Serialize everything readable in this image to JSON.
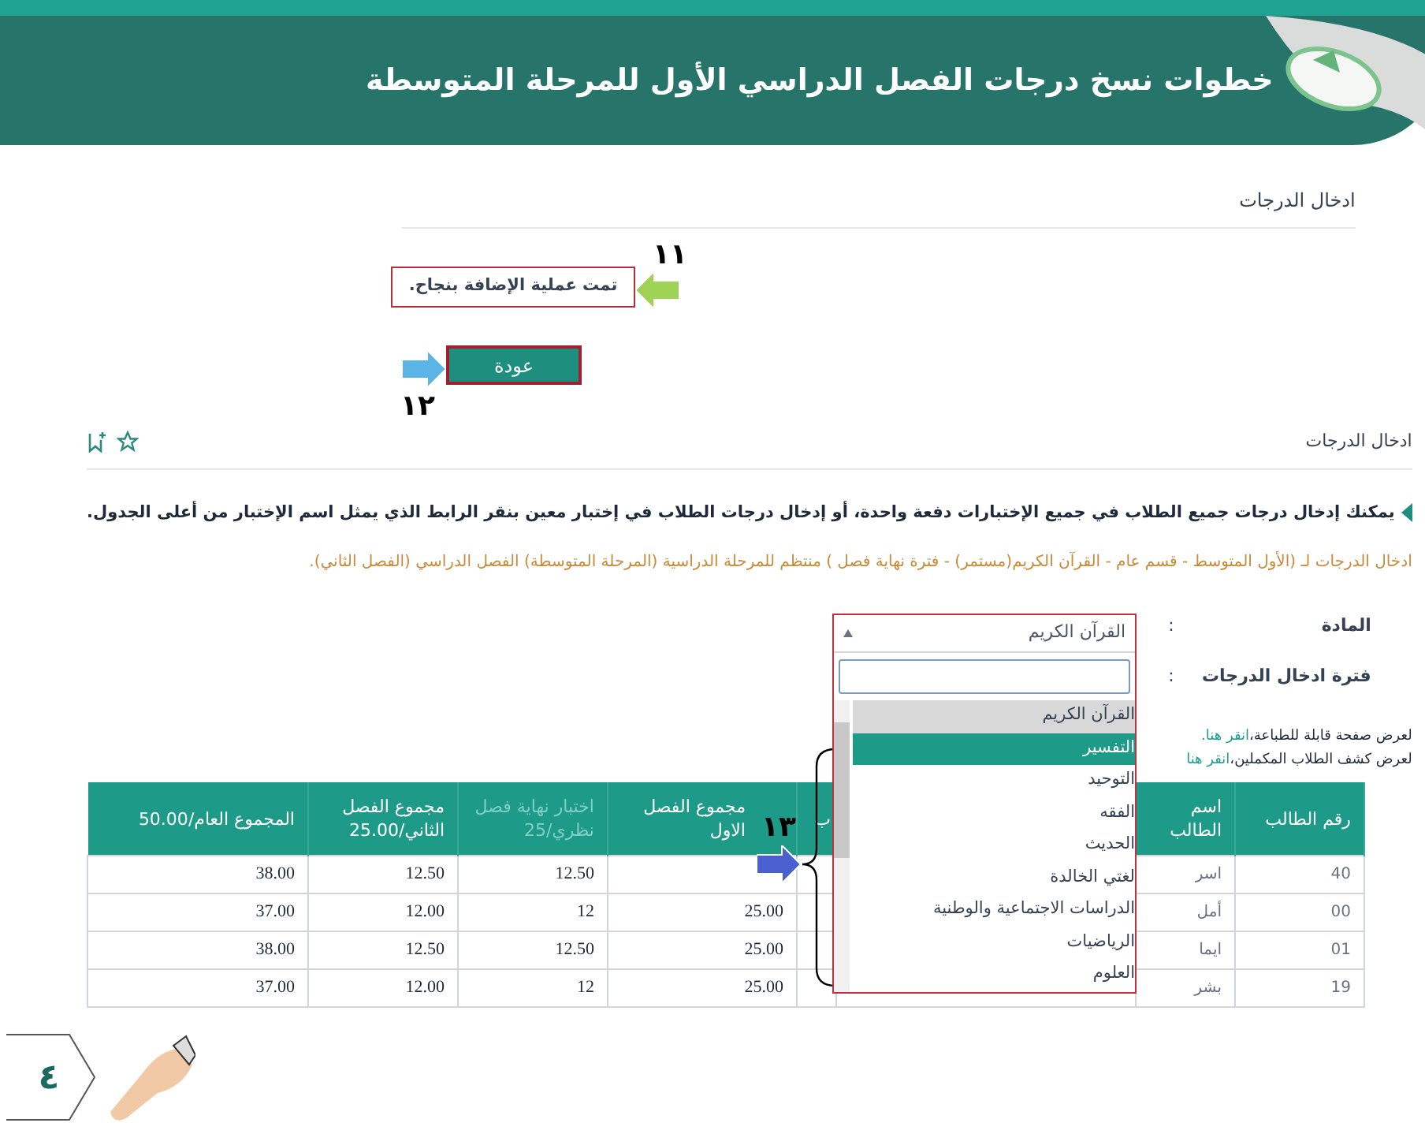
{
  "header": {
    "title": "خطوات نسخ درجات الفصل الدراسي الأول للمرحلة المتوسطة"
  },
  "result_panel": {
    "heading": "ادخال الدرجات",
    "message": "تمت عملية الإضافة بنجاح.",
    "back_button": "عودة"
  },
  "annotations": [
    {
      "number": "١١"
    },
    {
      "number": "١٢"
    },
    {
      "number": "١٣"
    }
  ],
  "grades_panel": {
    "heading": "ادخال الدرجات",
    "instruction": "يمكنك إدخال درجات جميع الطلاب في جميع الإختبارات دفعة واحدة، أو إدخال درجات الطلاب في إختبار معين بنقر الرابط الذي يمثل اسم الإختبار من أعلى الجدول.",
    "context": "ادخال الدرجات لـ (الأول المتوسط - قسم عام - القرآن الكريم(مستمر) - فترة نهاية فصل ) منتظم للمرحلة الدراسية (المرحلة المتوسطة) الفصل الدراسي (الفصل الثاني).",
    "fields": [
      {
        "label": "المادة",
        "colon": ":"
      },
      {
        "label": "فترة ادخال الدرجات",
        "colon": ":"
      }
    ],
    "subject_select": {
      "value": "القرآن الكريم",
      "expanded": true,
      "options": [
        {
          "label": "القرآن الكريم",
          "selected": true,
          "highlighted": false
        },
        {
          "label": "التفسير",
          "selected": false,
          "highlighted": true
        },
        {
          "label": "التوحيد",
          "selected": false,
          "highlighted": false
        },
        {
          "label": "الفقه",
          "selected": false,
          "highlighted": false
        },
        {
          "label": "الحديث",
          "selected": false,
          "highlighted": false
        },
        {
          "label": "لغتي الخالدة",
          "selected": false,
          "highlighted": false
        },
        {
          "label": "الدراسات الاجتماعية والوطنية",
          "selected": false,
          "highlighted": false
        },
        {
          "label": "الرياضيات",
          "selected": false,
          "highlighted": false
        },
        {
          "label": "العلوم",
          "selected": false,
          "highlighted": false
        }
      ]
    },
    "links": [
      {
        "text": "لعرض صفحة قابلة للطباعة،",
        "link": "انقر هنا."
      },
      {
        "text": "لعرض كشف الطلاب المكملين،",
        "link": "انقر هنا"
      }
    ],
    "table": {
      "headers": {
        "student_id": "رقم الطالب",
        "student_name": "اسم الطالب",
        "column_3": "ب",
        "first_term_total": "مجموع الفصل الاول",
        "final_exam": "اختبار نهاية فصل نظري/25",
        "second_term_total": "مجموع الفصل الثاني/25.00",
        "grand_total": "المجموع العام/50.00"
      },
      "rows": [
        {
          "student_id": "40",
          "student_name": "اسر",
          "final_exam": "12.50",
          "second_term_total": "12.50",
          "grand_total": "38.00"
        },
        {
          "student_id": "00",
          "student_name": "أمل",
          "first_term_total": "25.00",
          "final_exam": "12",
          "second_term_total": "12.00",
          "grand_total": "37.00"
        },
        {
          "student_id": "01",
          "student_name": "ايما",
          "first_term_total": "25.00",
          "final_exam": "12.50",
          "second_term_total": "12.50",
          "grand_total": "38.00"
        },
        {
          "student_id": "19",
          "student_name": "بشر",
          "first_term_total": "25.00",
          "final_exam": "12",
          "second_term_total": "12.00",
          "grand_total": "37.00"
        }
      ]
    }
  },
  "page_number": "٤"
}
